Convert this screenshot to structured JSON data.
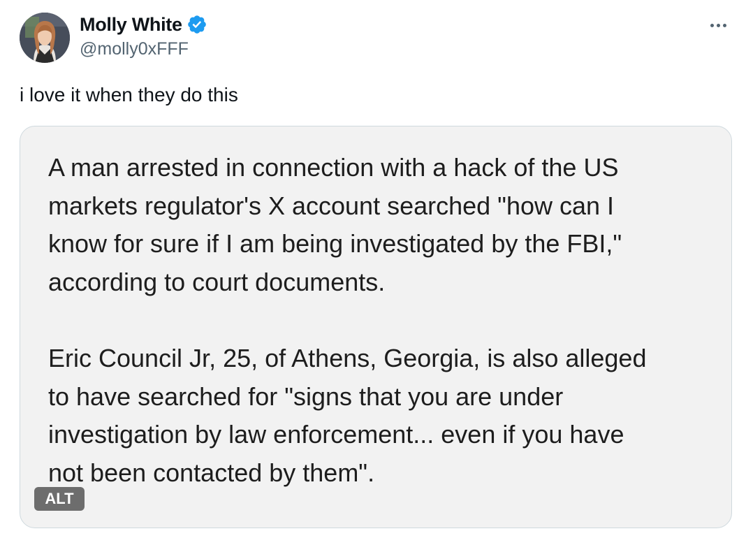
{
  "author": {
    "display_name": "Molly White",
    "handle": "@molly0xFFF",
    "verified": true
  },
  "tweet": {
    "text": "i love it when they do this"
  },
  "media": {
    "paragraphs": [
      {
        "lines": [
          "A man arrested in connection with a hack of the US",
          "markets regulator's X account searched \"how can I",
          "know for sure if I am being investigated by the FBI,\"",
          "according to court documents."
        ]
      },
      {
        "lines": [
          "Eric Council Jr, 25, of Athens, Georgia, is also alleged",
          "to have searched for \"signs that you are under",
          "investigation by law enforcement... even if you have",
          "not been contacted by them\"."
        ]
      }
    ],
    "alt_label": "ALT"
  },
  "icons": {
    "verified": "verified-badge-icon",
    "more": "more-options-icon"
  },
  "colors": {
    "verified_blue": "#1d9bf0",
    "secondary_text": "#536471",
    "media_background": "#f2f2f2"
  }
}
